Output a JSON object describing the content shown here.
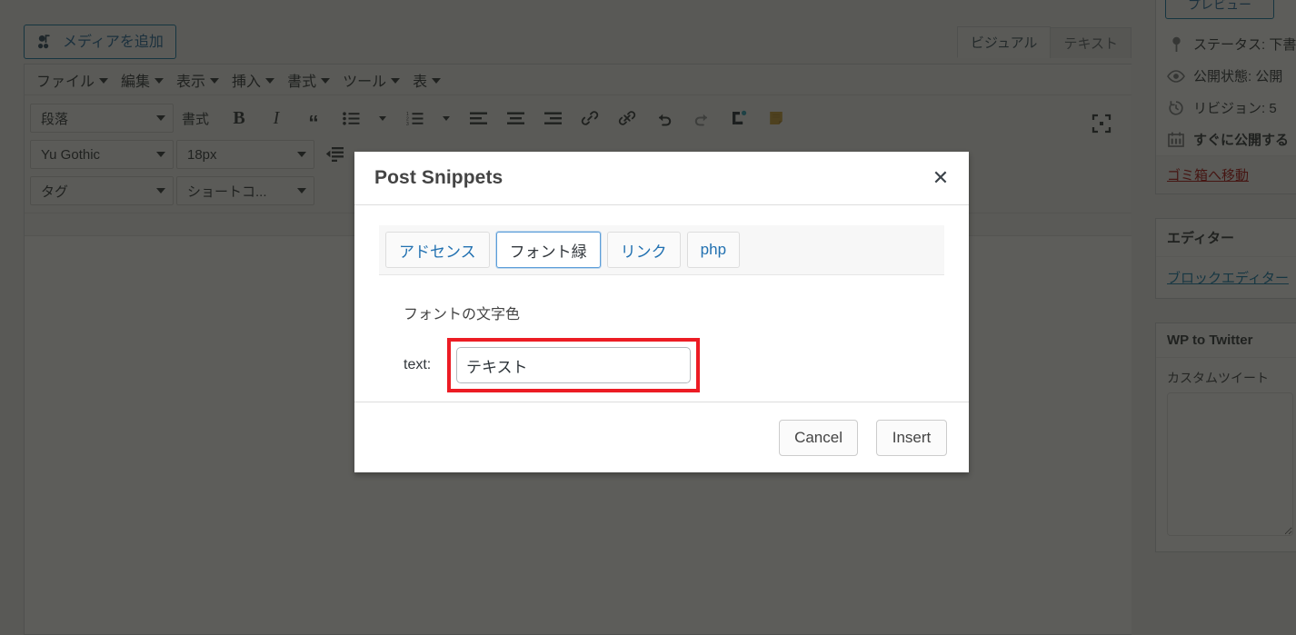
{
  "editor": {
    "add_media_button": "メディアを追加",
    "tabs": [
      {
        "label": "ビジュアル",
        "active": true
      },
      {
        "label": "テキスト",
        "active": false
      }
    ],
    "menubar": [
      {
        "label": "ファイル"
      },
      {
        "label": "編集"
      },
      {
        "label": "表示"
      },
      {
        "label": "挿入"
      },
      {
        "label": "書式"
      },
      {
        "label": "ツール"
      },
      {
        "label": "表"
      }
    ],
    "toolbar_row1": {
      "paragraph_select": "段落",
      "format_label": "書式",
      "bold": "B",
      "italic": "I",
      "blockquote": "“"
    },
    "toolbar_row2": {
      "font_select": "Yu Gothic",
      "size_select": "18px"
    },
    "toolbar_row3": {
      "tag_select": "タグ",
      "shortcode_select": "ショートコ..."
    }
  },
  "modal": {
    "title": "Post Snippets",
    "close_label": "✕",
    "tabs": [
      {
        "label": "アドセンス",
        "active": false
      },
      {
        "label": "フォント緑",
        "active": true
      },
      {
        "label": "リンク",
        "active": false
      },
      {
        "label": "php",
        "active": false
      }
    ],
    "description": "フォントの文字色",
    "field": {
      "label": "text:",
      "value": "テキスト",
      "placeholder": ""
    },
    "buttons": {
      "cancel": "Cancel",
      "insert": "Insert"
    },
    "highlight_color": "#ec1c24",
    "accent_color": "#2271b1"
  },
  "sidebar": {
    "publish": {
      "preview_button": "プレビュー",
      "lines": [
        {
          "icon": "pin-icon",
          "text": "ステータス: 下書き"
        },
        {
          "icon": "eye-icon",
          "text": "公開状態: 公開"
        },
        {
          "icon": "clock-icon",
          "text": "リビジョン: 5"
        },
        {
          "icon": "calendar-icon",
          "text": "すぐに公開する"
        }
      ],
      "trash_link": "ゴミ箱へ移動"
    },
    "editor_box": {
      "title": "エディター",
      "link": "ブロックエディター"
    },
    "twitter_box": {
      "title": "WP to Twitter",
      "field_label": "カスタムツイート",
      "textarea_value": ""
    }
  }
}
